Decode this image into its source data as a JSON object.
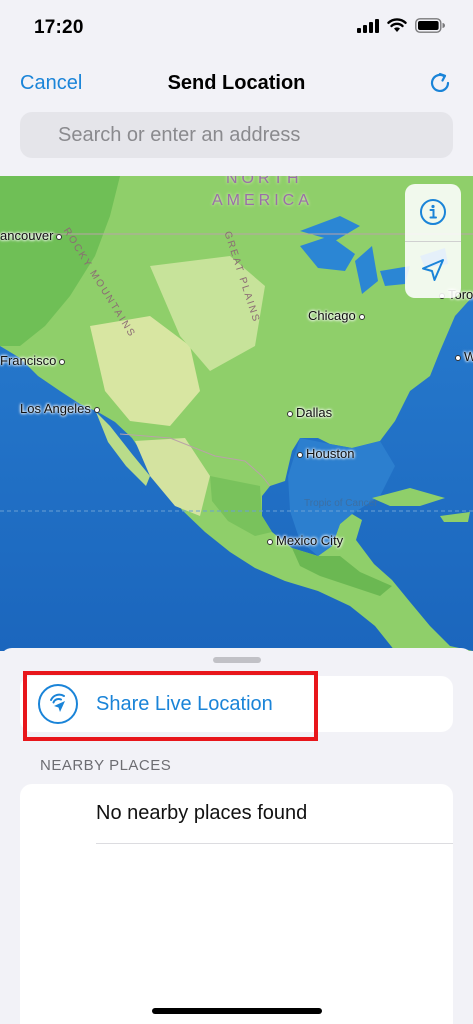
{
  "status_bar": {
    "time": "17:20",
    "icons": [
      "cellular-signal-icon",
      "wifi-icon",
      "battery-icon"
    ]
  },
  "nav": {
    "cancel_label": "Cancel",
    "title": "Send Location",
    "refresh_icon": "refresh-icon"
  },
  "search": {
    "placeholder": "Search or enter an address"
  },
  "map": {
    "region_labels": [
      "NORTH",
      "AMERICA"
    ],
    "features": [
      "ROCKY MOUNTAINS",
      "GREAT PLAINS",
      "Tropic of Cancer"
    ],
    "cities": [
      "ancouver",
      "Francisco",
      "Los Angeles",
      "Chicago",
      "Dallas",
      "Houston",
      "Mexico City",
      "W",
      "Toron"
    ],
    "controls": [
      "info-icon",
      "location-arrow-icon"
    ]
  },
  "sheet": {
    "share_live_label": "Share Live Location",
    "share_live_icon": "live-location-icon",
    "section_header": "NEARBY PLACES",
    "empty_message": "No nearby places found"
  },
  "colors": {
    "accent": "#1a84d8",
    "highlight": "#e8161b",
    "sheet_bg": "#f2f2f7",
    "ocean": "#1f74c7",
    "land": "#8fcf6a"
  }
}
